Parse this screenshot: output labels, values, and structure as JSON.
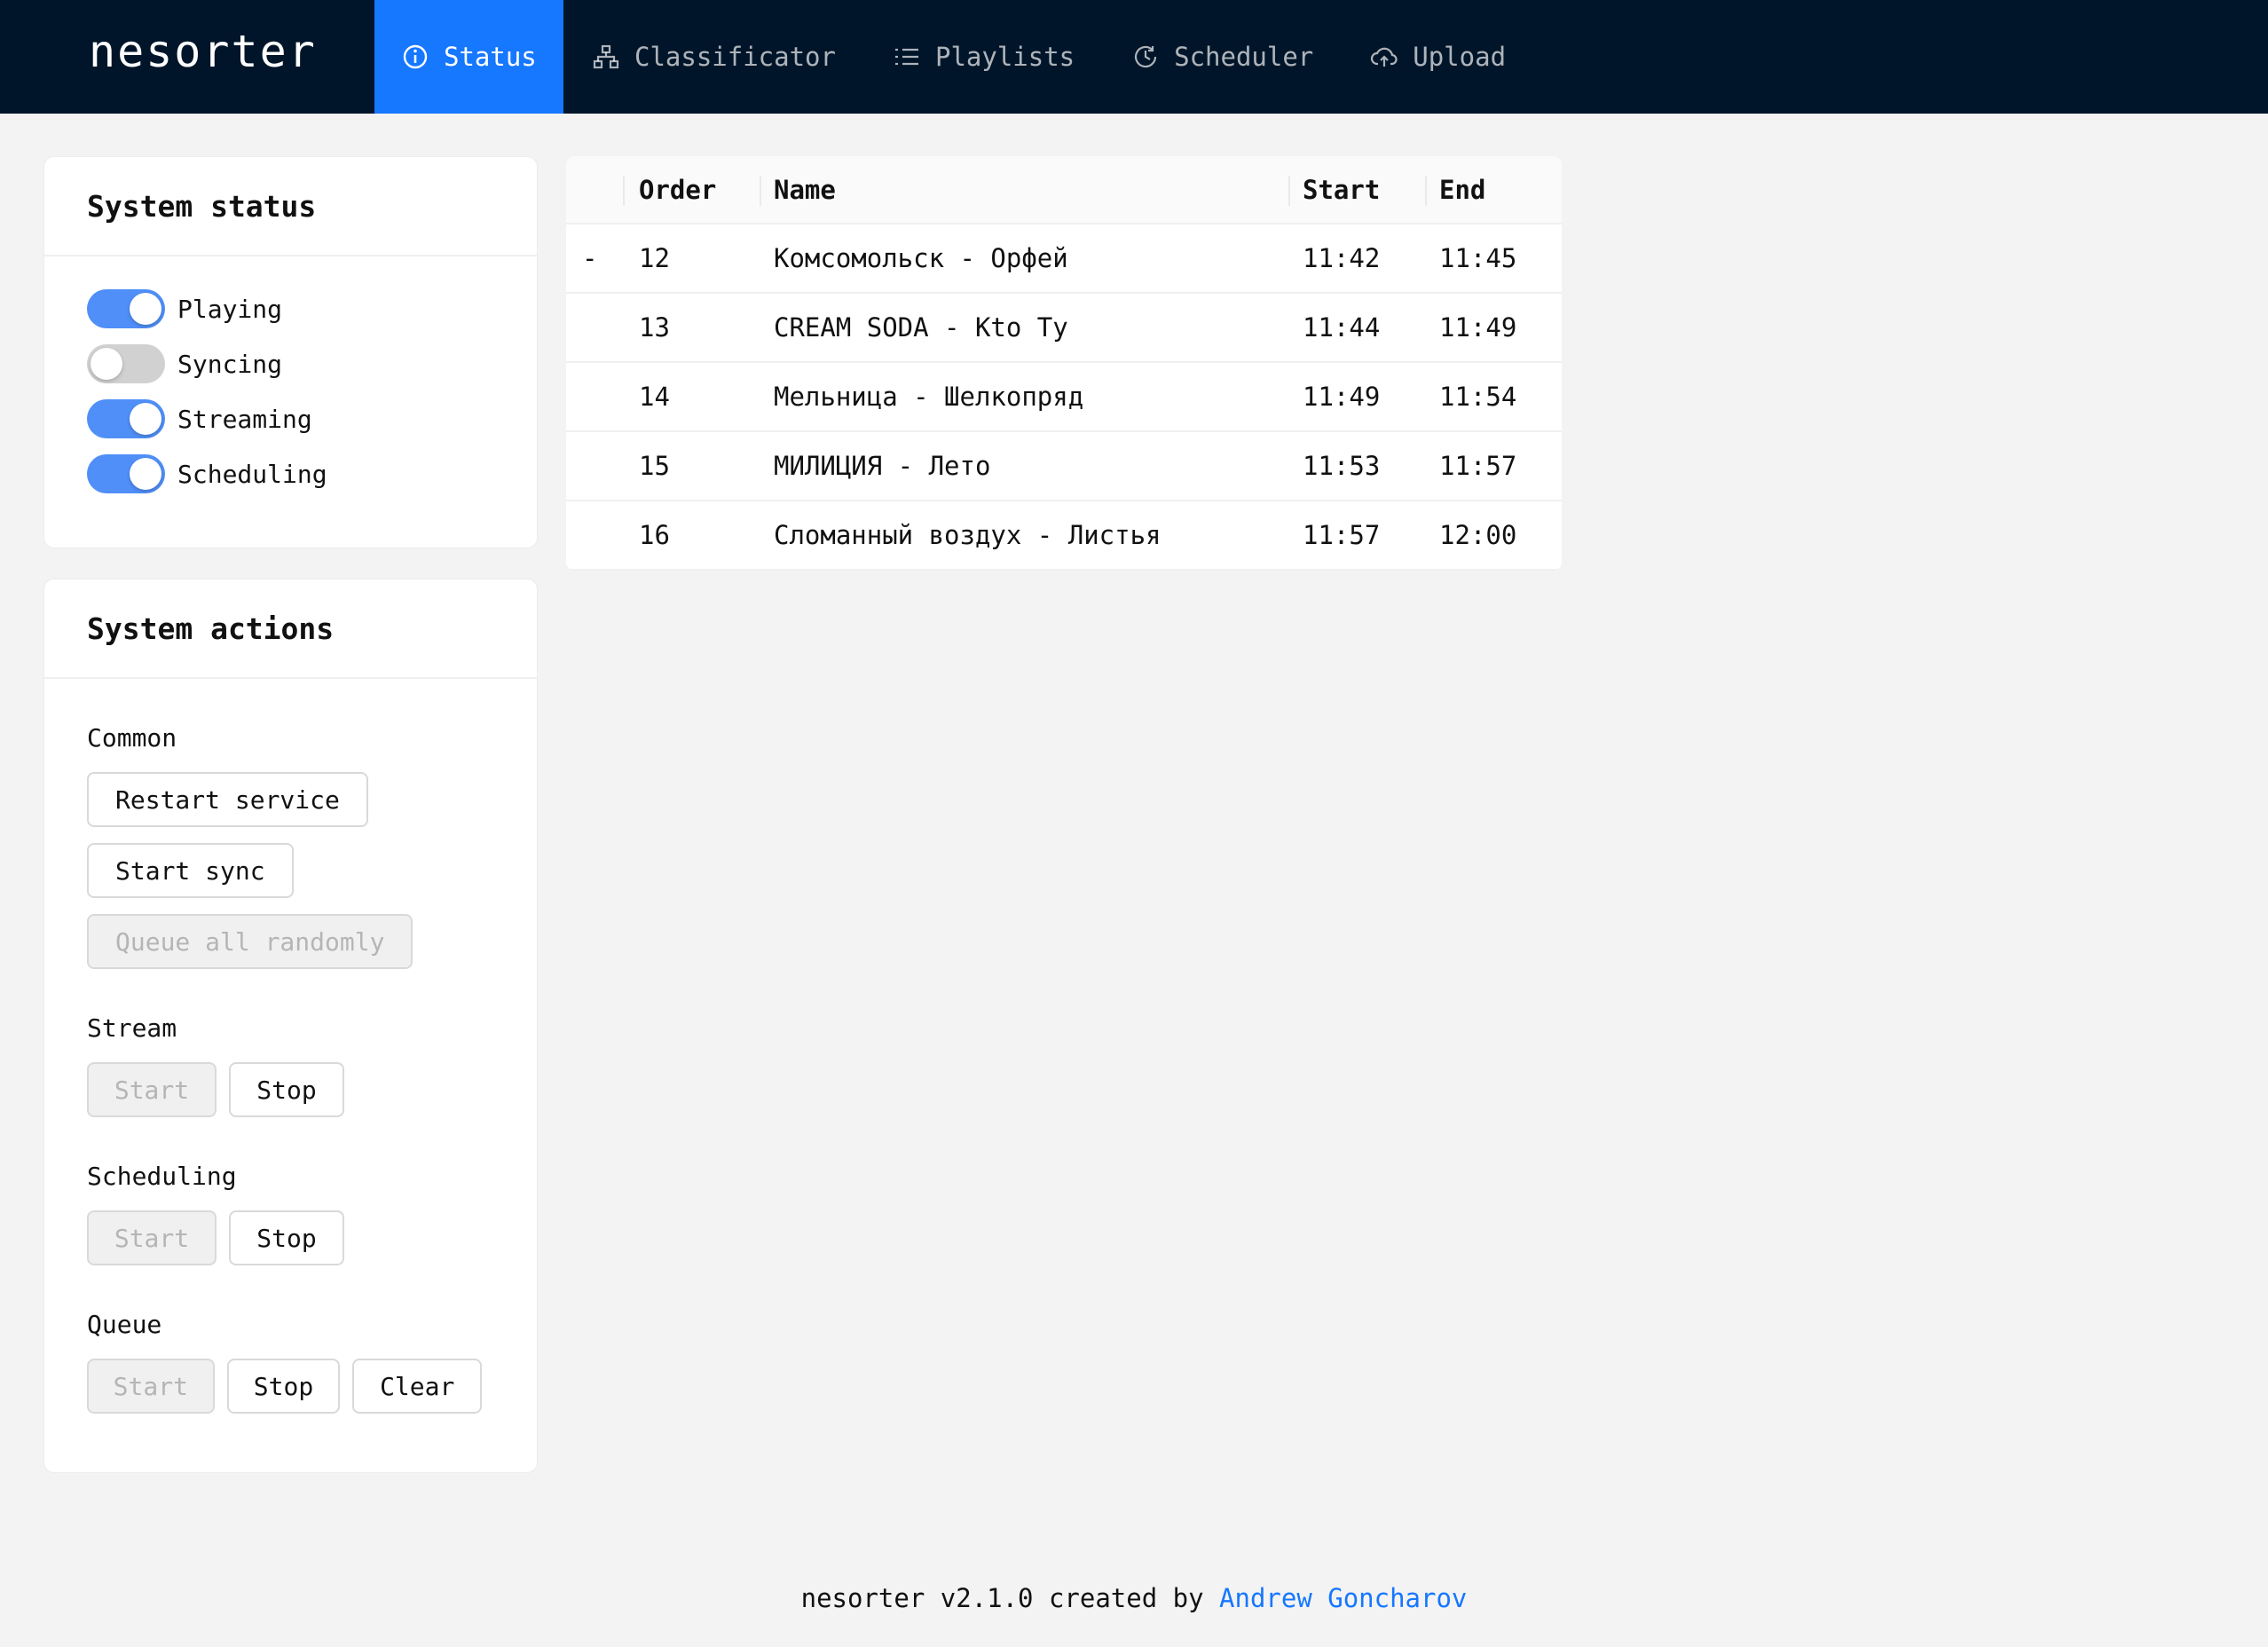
{
  "app": {
    "logo": "nesorter"
  },
  "nav": {
    "items": [
      {
        "label": "Status",
        "icon": "info-icon"
      },
      {
        "label": "Classificator",
        "icon": "hierarchy-icon"
      },
      {
        "label": "Playlists",
        "icon": "list-icon"
      },
      {
        "label": "Scheduler",
        "icon": "clock-icon"
      },
      {
        "label": "Upload",
        "icon": "cloud-upload-icon"
      }
    ],
    "active": "Status"
  },
  "system_status": {
    "title": "System status",
    "switches": [
      {
        "label": "Playing",
        "on": true
      },
      {
        "label": "Syncing",
        "on": false
      },
      {
        "label": "Streaming",
        "on": true
      },
      {
        "label": "Scheduling",
        "on": true
      }
    ]
  },
  "system_actions": {
    "title": "System actions",
    "common": {
      "label": "Common",
      "restart": "Restart service",
      "start_sync": "Start sync",
      "queue_random": "Queue all randomly"
    },
    "stream": {
      "label": "Stream",
      "start": "Start",
      "stop": "Stop"
    },
    "scheduling": {
      "label": "Scheduling",
      "start": "Start",
      "stop": "Stop"
    },
    "queue": {
      "label": "Queue",
      "start": "Start",
      "stop": "Stop",
      "clear": "Clear"
    }
  },
  "queue_table": {
    "headers": {
      "order": "Order",
      "name": "Name",
      "start": "Start",
      "end": "End"
    },
    "rows": [
      {
        "marker": "-",
        "order": "12",
        "name": "Комсомольск - Орфей",
        "start": "11:42",
        "end": "11:45"
      },
      {
        "marker": "",
        "order": "13",
        "name": "CREAM SODA - Kto Ty",
        "start": "11:44",
        "end": "11:49"
      },
      {
        "marker": "",
        "order": "14",
        "name": "Мельница - Шелкопряд",
        "start": "11:49",
        "end": "11:54"
      },
      {
        "marker": "",
        "order": "15",
        "name": "МИЛИЦИЯ - Лето",
        "start": "11:53",
        "end": "11:57"
      },
      {
        "marker": "",
        "order": "16",
        "name": "Сломанный воздух - Листья",
        "start": "11:57",
        "end": "12:00"
      }
    ]
  },
  "footer": {
    "text": "nesorter v2.1.0 created by",
    "author": "Andrew Goncharov"
  },
  "colors": {
    "header_bg": "#001529",
    "accent": "#1677ff",
    "switch_on": "#4f8ff7",
    "switch_off": "#d1d1d1"
  }
}
